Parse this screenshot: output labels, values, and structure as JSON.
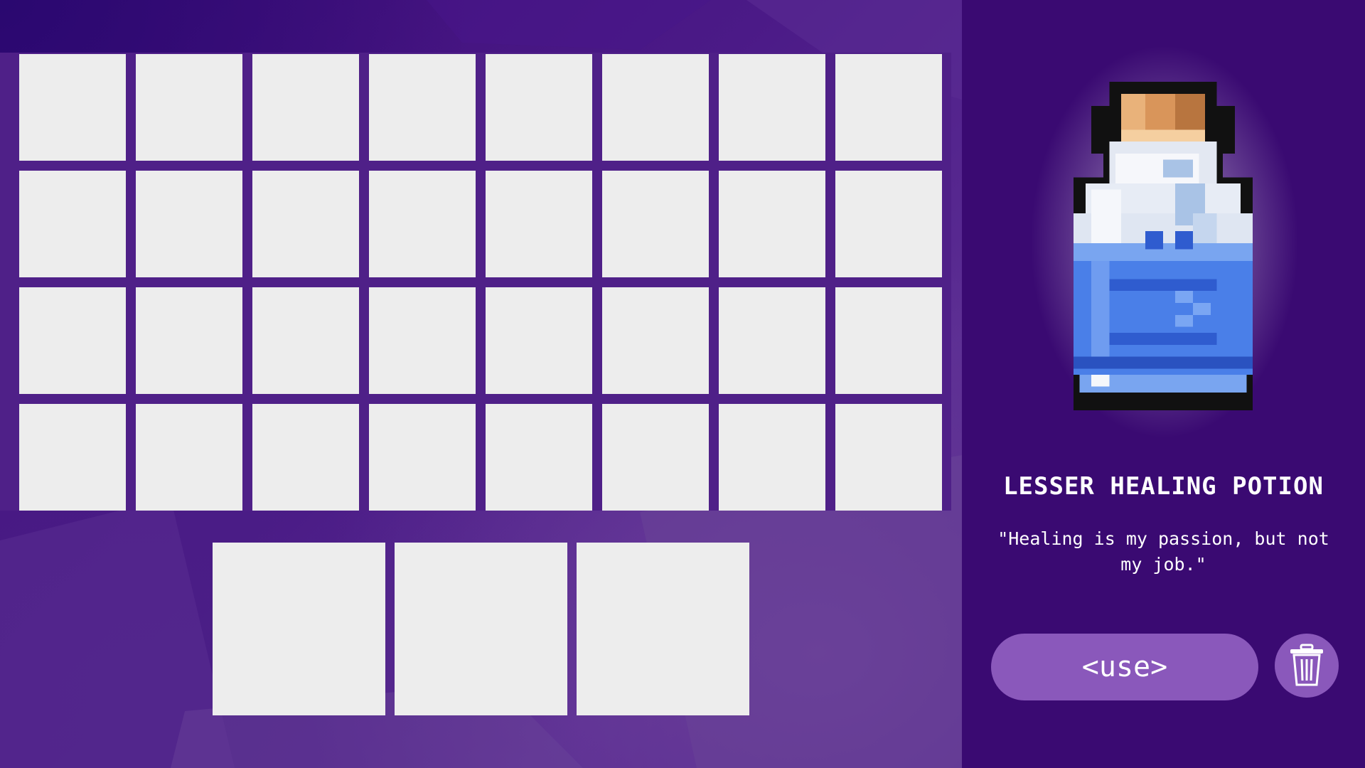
{
  "inventory": {
    "slot_count": 32,
    "craft_slot_count": 3
  },
  "selected_item": {
    "name": "LESSER HEALING POTION",
    "description": "\"Healing is my passion, but not my job.\"",
    "icon": "blue-potion-bottle-icon"
  },
  "actions": {
    "use_label": "<use>",
    "trash_icon": "trash-icon"
  },
  "colors": {
    "background": "#3e0f78",
    "panel": "#3a0a72",
    "slot": "#ededed",
    "button": "#8a58bb",
    "text": "#ffffff",
    "potion_liquid": "#4a7fe8"
  }
}
